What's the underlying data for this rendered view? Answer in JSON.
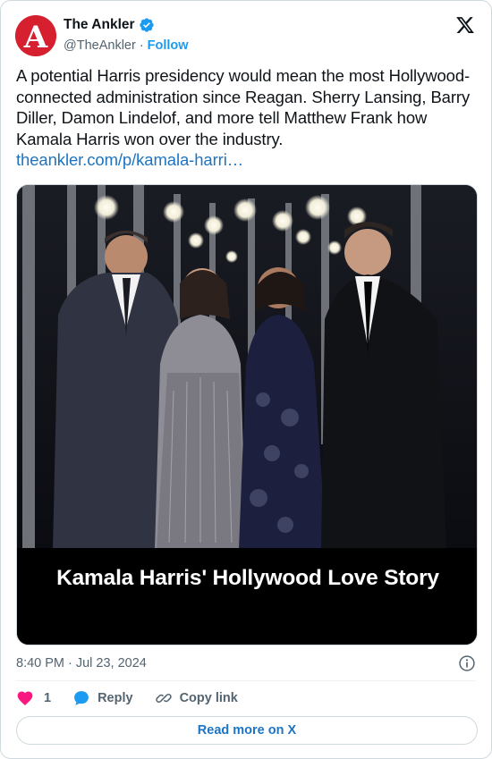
{
  "account": {
    "name": "The Ankler",
    "handle": "@TheAnkler",
    "separator": "·",
    "follow_label": "Follow",
    "avatar_letter": "A",
    "brand_color": "#d6202f"
  },
  "tweet": {
    "text": "A potential Harris presidency would mean the most Hollywood-connected administration since Reagan. Sherry Lansing, Barry Diller, Damon Lindelof, and more tell Matthew Frank how Kamala Harris won over the industry.",
    "link_text": "theankler.com/p/kamala-harri…"
  },
  "media": {
    "caption": "Kamala Harris' Hollywood Love Story"
  },
  "meta": {
    "time": "8:40 PM",
    "separator": "·",
    "date": "Jul 23, 2024"
  },
  "actions": {
    "like_count": "1",
    "reply_label": "Reply",
    "copy_label": "Copy link"
  },
  "footer": {
    "read_more_label": "Read more on X"
  },
  "colors": {
    "accent": "#1d9bf0",
    "link": "#1d74c2",
    "like": "#f91880",
    "muted": "#536471"
  },
  "icons": [
    "verified-badge-icon",
    "x-logo-icon",
    "info-icon",
    "heart-icon",
    "reply-bubble-icon",
    "link-icon"
  ]
}
